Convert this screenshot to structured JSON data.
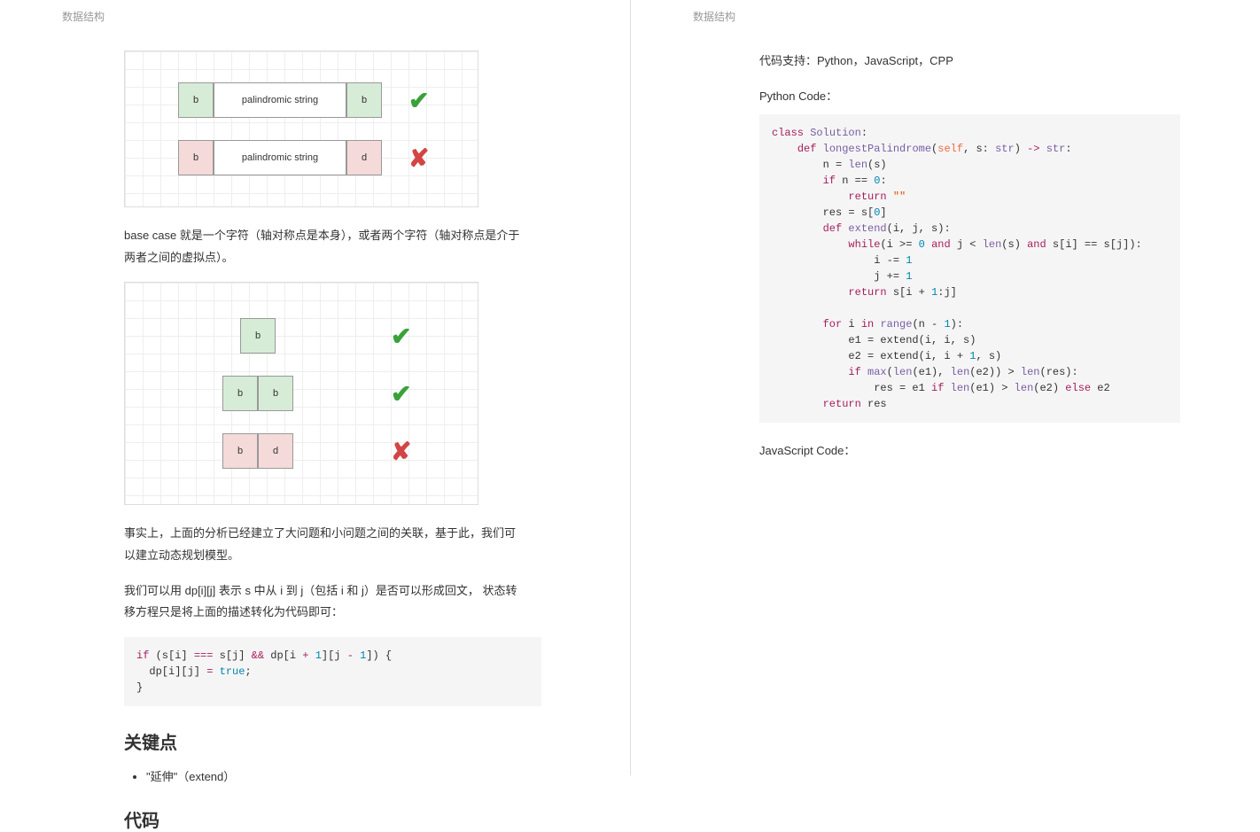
{
  "header": {
    "left": "数据结构",
    "right": "数据结构"
  },
  "left": {
    "diagram1": {
      "row1": {
        "cellA": "b",
        "mid": "palindromic string",
        "cellB": "b",
        "ok": "✔"
      },
      "row2": {
        "cellA": "b",
        "mid": "palindromic string",
        "cellB": "d",
        "ok": "✘"
      }
    },
    "para1": "base case 就是一个字符（轴对称点是本身），或者两个字符（轴对称点是介于两者之间的虚拟点）。",
    "diagram2": {
      "row1": {
        "cellA": "b",
        "ok": "✔"
      },
      "row2": {
        "cellA": "b",
        "cellB": "b",
        "ok": "✔"
      },
      "row3": {
        "cellA": "b",
        "cellB": "d",
        "ok": "✘"
      }
    },
    "para2": "事实上，上面的分析已经建立了大问题和小问题之间的关联，基于此，我们可以建立动态规划模型。",
    "para3": "我们可以用 dp[i][j] 表示 s 中从 i 到 j（包括 i 和 j）是否可以形成回文， 状态转移方程只是将上面的描述转化为代码即可：",
    "codeDP": {
      "line1a": "if",
      "line1b": " (s[i] ",
      "line1c": "===",
      "line1d": " s[j] ",
      "line1e": "&&",
      "line1f": " dp[i ",
      "line1g": "+",
      "line1h": " ",
      "line1i": "1",
      "line1j": "][j ",
      "line1k": "-",
      "line1l": " ",
      "line1m": "1",
      "line1n": "]) {",
      "line2a": "  dp[i][j] ",
      "line2b": "=",
      "line2c": " ",
      "line2d": "true",
      "line2e": ";",
      "line3": "}"
    },
    "h_key": "关键点",
    "bullet1": "\"延伸\"（extend）",
    "h_code": "代码"
  },
  "right": {
    "support": "代码支持：Python，JavaScript，CPP",
    "pyLabel": "Python Code：",
    "jsLabel": "JavaScript Code：",
    "py": {
      "l1a": "class",
      "l1b": " ",
      "l1c": "Solution",
      "l1d": ":",
      "l2a": "    ",
      "l2b": "def",
      "l2c": " ",
      "l2d": "longestPalindrome",
      "l2e": "(",
      "l2f": "self",
      "l2g": ", s: ",
      "l2h": "str",
      "l2i": ") ",
      "l2j": "->",
      "l2k": " ",
      "l2l": "str",
      "l2m": ":",
      "l3a": "        n = ",
      "l3b": "len",
      "l3c": "(s)",
      "l4a": "        ",
      "l4b": "if",
      "l4c": " n == ",
      "l4d": "0",
      "l4e": ":",
      "l5a": "            ",
      "l5b": "return",
      "l5c": " ",
      "l5d": "\"\"",
      "l6a": "        res = s[",
      "l6b": "0",
      "l6c": "]",
      "l7a": "        ",
      "l7b": "def",
      "l7c": " ",
      "l7d": "extend",
      "l7e": "(i, j, s):",
      "l8a": "            ",
      "l8b": "while",
      "l8c": "(i >= ",
      "l8d": "0",
      "l8e": " ",
      "l8f": "and",
      "l8g": " j < ",
      "l8h": "len",
      "l8i": "(s) ",
      "l8j": "and",
      "l8k": " s[i] == s[j]):",
      "l9a": "                i -= ",
      "l9b": "1",
      "l10a": "                j += ",
      "l10b": "1",
      "l11a": "            ",
      "l11b": "return",
      "l11c": " s[i + ",
      "l11d": "1",
      "l11e": ":j]",
      "l12": "",
      "l13a": "        ",
      "l13b": "for",
      "l13c": " i ",
      "l13d": "in",
      "l13e": " ",
      "l13f": "range",
      "l13g": "(n - ",
      "l13h": "1",
      "l13i": "):",
      "l14a": "            e1 = extend(i, i, s)",
      "l15a": "            e2 = extend(i, i + ",
      "l15b": "1",
      "l15c": ", s)",
      "l16a": "            ",
      "l16b": "if",
      "l16c": " ",
      "l16d": "max",
      "l16e": "(",
      "l16f": "len",
      "l16g": "(e1), ",
      "l16h": "len",
      "l16i": "(e2)) > ",
      "l16j": "len",
      "l16k": "(res):",
      "l17a": "                res = e1 ",
      "l17b": "if",
      "l17c": " ",
      "l17d": "len",
      "l17e": "(e1) > ",
      "l17f": "len",
      "l17g": "(e2) ",
      "l17h": "else",
      "l17i": " e2",
      "l18a": "        ",
      "l18b": "return",
      "l18c": " res"
    }
  }
}
